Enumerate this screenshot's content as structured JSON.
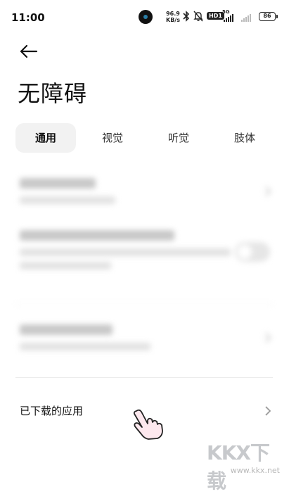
{
  "status_bar": {
    "time": "11:00",
    "net_speed_value": "96.9",
    "net_speed_unit": "KB/s",
    "hd_label": "HD1",
    "signal_label": "5G",
    "battery": "86",
    "icons": [
      "bluetooth-icon",
      "mute-bell-icon",
      "signal-icon",
      "battery-icon"
    ]
  },
  "header": {
    "back_icon": "arrow-left-icon",
    "title": "无障碍"
  },
  "tabs": [
    {
      "label": "通用",
      "active": true
    },
    {
      "label": "视觉",
      "active": false
    },
    {
      "label": "听觉",
      "active": false
    },
    {
      "label": "肢体",
      "active": false
    }
  ],
  "settings": {
    "downloaded_apps": {
      "label": "已下载的应用"
    }
  },
  "colors": {
    "background": "#ffffff",
    "active_tab_bg": "#f2f2f2",
    "divider": "#ececec",
    "watermark": "#c7c9cc"
  },
  "watermark": {
    "logo": "KKX下载",
    "url": "www.kkx.net"
  }
}
